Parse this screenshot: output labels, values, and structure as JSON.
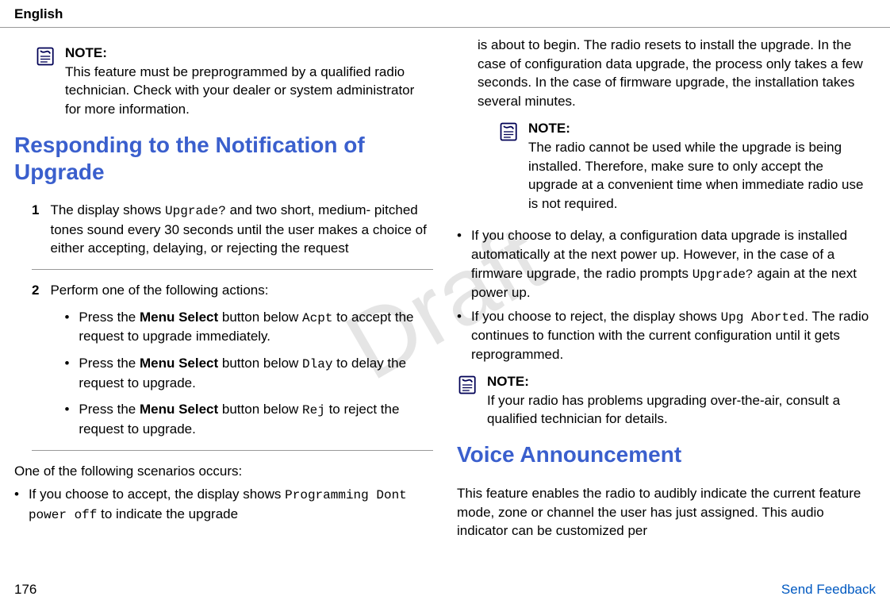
{
  "header": {
    "language": "English"
  },
  "watermark": "Draft",
  "col1": {
    "note1_label": "NOTE:",
    "note1_text": "This feature must be preprogrammed by a qualified radio technician. Check with your dealer or system administrator for more information.",
    "h2": "Responding to the Notification of Upgrade",
    "step1_num": "1",
    "step1_a": "The display shows ",
    "step1_mono": "Upgrade?",
    "step1_b": " and two short, medium- pitched tones sound every 30 seconds until the user makes a choice of either accepting, delaying, or rejecting the request",
    "step2_num": "2",
    "step2_intro": "Perform one of the following actions:",
    "sb1_a": "Press the ",
    "sb1_bold": "Menu Select",
    "sb1_b": " button below ",
    "sb1_mono": "Acpt",
    "sb1_c": " to accept the request to upgrade immediately.",
    "sb2_a": "Press the ",
    "sb2_bold": "Menu Select",
    "sb2_b": " button below ",
    "sb2_mono": "Dlay",
    "sb2_c": " to delay the request to upgrade.",
    "sb3_a": "Press the ",
    "sb3_bold": "Menu Select",
    "sb3_b": " button below ",
    "sb3_mono": "Rej",
    "sb3_c": " to reject the request to upgrade.",
    "scenarios": "One of the following scenarios occurs:",
    "b1_a": "If you choose to accept, the display shows ",
    "b1_mono": "Programming Dont power off",
    "b1_b": " to indicate the upgrade"
  },
  "col2": {
    "cont": "is about to begin. The radio resets to install the upgrade. In the case of configuration data upgrade, the process only takes a few seconds. In the case of firmware upgrade, the installation takes several minutes.",
    "note2_label": "NOTE:",
    "note2_text": "The radio cannot be used while the upgrade is being installed. Therefore, make sure to only accept the upgrade at a convenient time when immediate radio use is not required.",
    "b2_a": "If you choose to delay, a configuration data upgrade is installed automatically at the next power up. However, in the case of a firmware upgrade, the radio prompts ",
    "b2_mono": "Upgrade?",
    "b2_b": " again at the next power up.",
    "b3_a": "If you choose to reject, the display shows ",
    "b3_mono": "Upg Aborted",
    "b3_b": ". The radio continues to function with the current configuration until it gets reprogrammed.",
    "note3_label": "NOTE:",
    "note3_text": "If your radio has problems upgrading over-the-air, consult a qualified technician for details.",
    "h2": "Voice Announcement",
    "va_text": "This feature enables the radio to audibly indicate the current feature mode, zone or channel the user has just assigned. This audio indicator can be customized per"
  },
  "footer": {
    "page": "176",
    "link": "Send Feedback"
  }
}
